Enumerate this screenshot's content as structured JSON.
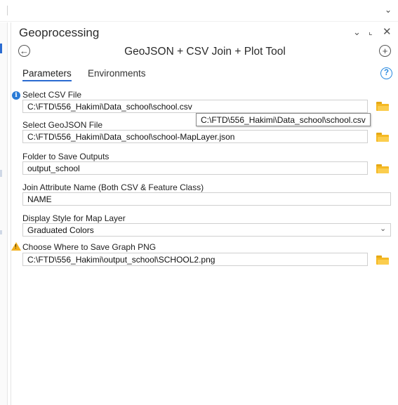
{
  "colors": {
    "accent": "#2a6bd1",
    "folder": "#f5b924",
    "info": "#2a7bd6",
    "warning": "#f2b01e",
    "help": "#2a8ae0"
  },
  "window": {
    "title": "Geoprocessing",
    "controls": {
      "dropdown_icon": "chevron-down-icon",
      "pin_icon": "pin-icon",
      "close_icon": "close-icon"
    }
  },
  "toolbar": {
    "tool_name": "GeoJSON + CSV Join + Plot Tool",
    "back_icon": "back-arrow-icon",
    "add_icon": "add-icon"
  },
  "tabs": [
    {
      "label": "Parameters",
      "active": true
    },
    {
      "label": "Environments",
      "active": false
    }
  ],
  "params": {
    "csv": {
      "label": "Select CSV File",
      "value": "C:\\FTD\\556_Hakimi\\Data_school\\school.csv",
      "status_icon": "info-icon"
    },
    "geojson": {
      "label": "Select GeoJSON File",
      "value": "C:\\FTD\\556_Hakimi\\Data_school\\school-MapLayer.json"
    },
    "output_folder": {
      "label": "Folder to Save Outputs",
      "value": "output_school"
    },
    "join_attr": {
      "label": "Join Attribute Name (Both CSV & Feature Class)",
      "value": "NAME"
    },
    "display_style": {
      "label": "Display Style for Map Layer",
      "value": "Graduated Colors"
    },
    "graph_png": {
      "label": "Choose Where to Save Graph PNG",
      "value": "C:\\FTD\\556_Hakimi\\output_school\\SCHOOL2.png",
      "status_icon": "warning-icon"
    }
  },
  "tooltip": {
    "text": "C:\\FTD\\556_Hakimi\\Data_school\\school.csv"
  }
}
